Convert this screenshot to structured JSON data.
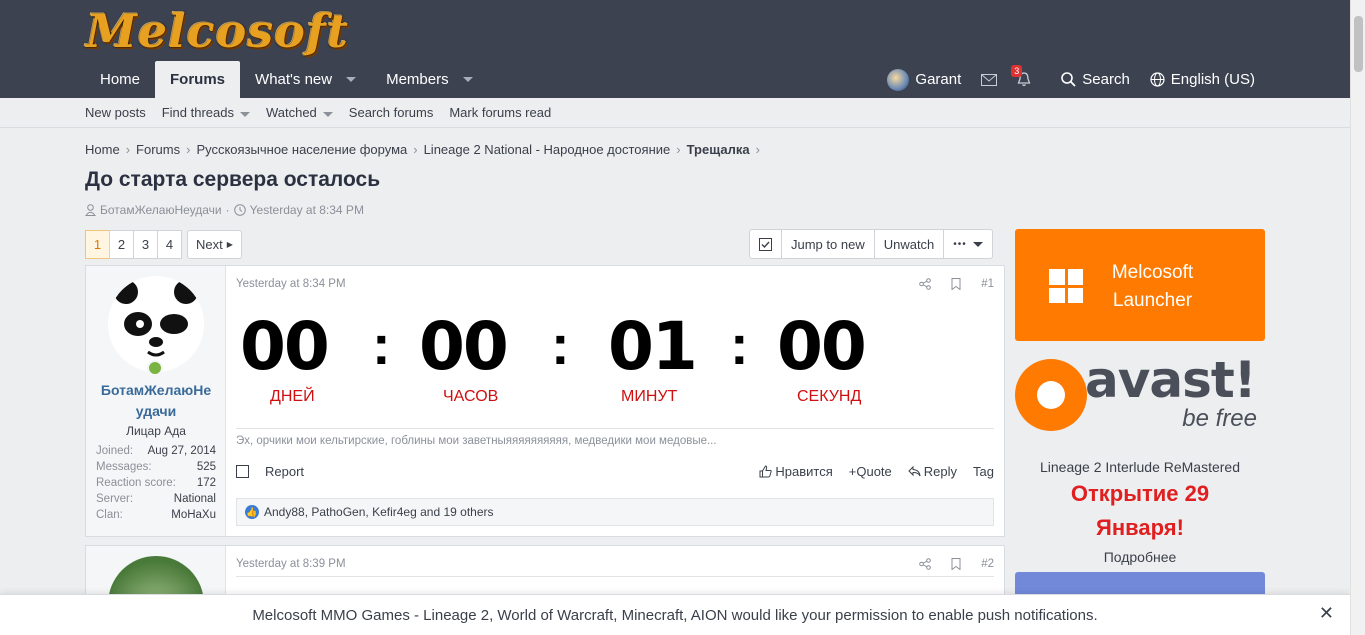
{
  "header": {
    "logo_text": "Melcosoft",
    "nav": [
      {
        "label": "Home"
      },
      {
        "label": "Forums"
      },
      {
        "label": "What's new"
      },
      {
        "label": "Members"
      }
    ],
    "user_name": "Garant",
    "alerts_count": "3",
    "search_label": "Search",
    "language_label": "English (US)"
  },
  "subnav": {
    "items": [
      "New posts",
      "Find threads",
      "Watched",
      "Search forums",
      "Mark forums read"
    ]
  },
  "breadcrumb": [
    "Home",
    "Forums",
    "Русскоязычное население форума",
    "Lineage 2 National - Народное достояние",
    "Трещалка"
  ],
  "thread": {
    "title": "До старта сервера осталось",
    "author": "БотамЖелаюНеудачи",
    "date": "Yesterday at 8:34 PM"
  },
  "pagination": {
    "pages": [
      "1",
      "2",
      "3",
      "4"
    ],
    "next_label": "Next"
  },
  "tools": {
    "jump_label": "Jump to new",
    "unwatch_label": "Unwatch",
    "more_label": "•••"
  },
  "post1": {
    "user_name_line1": "БотамЖелаюНе",
    "user_name_line2": "удачи",
    "user_title": "Лицар Ада",
    "stats": [
      {
        "k": "Joined:",
        "v": "Aug 27, 2014"
      },
      {
        "k": "Messages:",
        "v": "525"
      },
      {
        "k": "Reaction score:",
        "v": "172"
      },
      {
        "k": "Server:",
        "v": "National"
      },
      {
        "k": "Clan:",
        "v": "MoHaXu"
      }
    ],
    "date": "Yesterday at 8:34 PM",
    "num": "#1",
    "countdown": {
      "days": "00",
      "hours": "00",
      "minutes": "01",
      "seconds": "00",
      "days_label": "ДНЕЙ",
      "hours_label": "ЧАСОВ",
      "minutes_label": "МИНУТ",
      "seconds_label": "СЕКУНД"
    },
    "signature": "Эх, орчики мои кельтирские, гоблины мои заветныяяяяяяяяяя, медведики мои медовые...",
    "report_label": "Report",
    "like_label": "Нравится",
    "quote_label": "Quote",
    "reply_label": "Reply",
    "tag_label": "Tag",
    "reactions_text": "Andy88, PathoGen, Kefir4eg and 19 others"
  },
  "post2": {
    "date": "Yesterday at 8:39 PM",
    "num": "#2"
  },
  "sidebar": {
    "launcher_line1": "Melcosoft",
    "launcher_line2": "Launcher",
    "avast_text": "avast!",
    "avast_slogan": "be free",
    "server_name": "Lineage 2 Interlude ReMastered",
    "opening_line1": "Открытие 29",
    "opening_line2": "Января!",
    "more_label": "Подробнее"
  },
  "push": {
    "message": "Melcosoft MMO Games - Lineage 2, World of Warcraft, Minecraft, AION would like your permission to enable push notifications."
  },
  "colors": {
    "header_bg": "#3c4250",
    "accent_orange": "#ff7a00",
    "countdown_label": "#d01010",
    "opening_red": "#e02020"
  }
}
